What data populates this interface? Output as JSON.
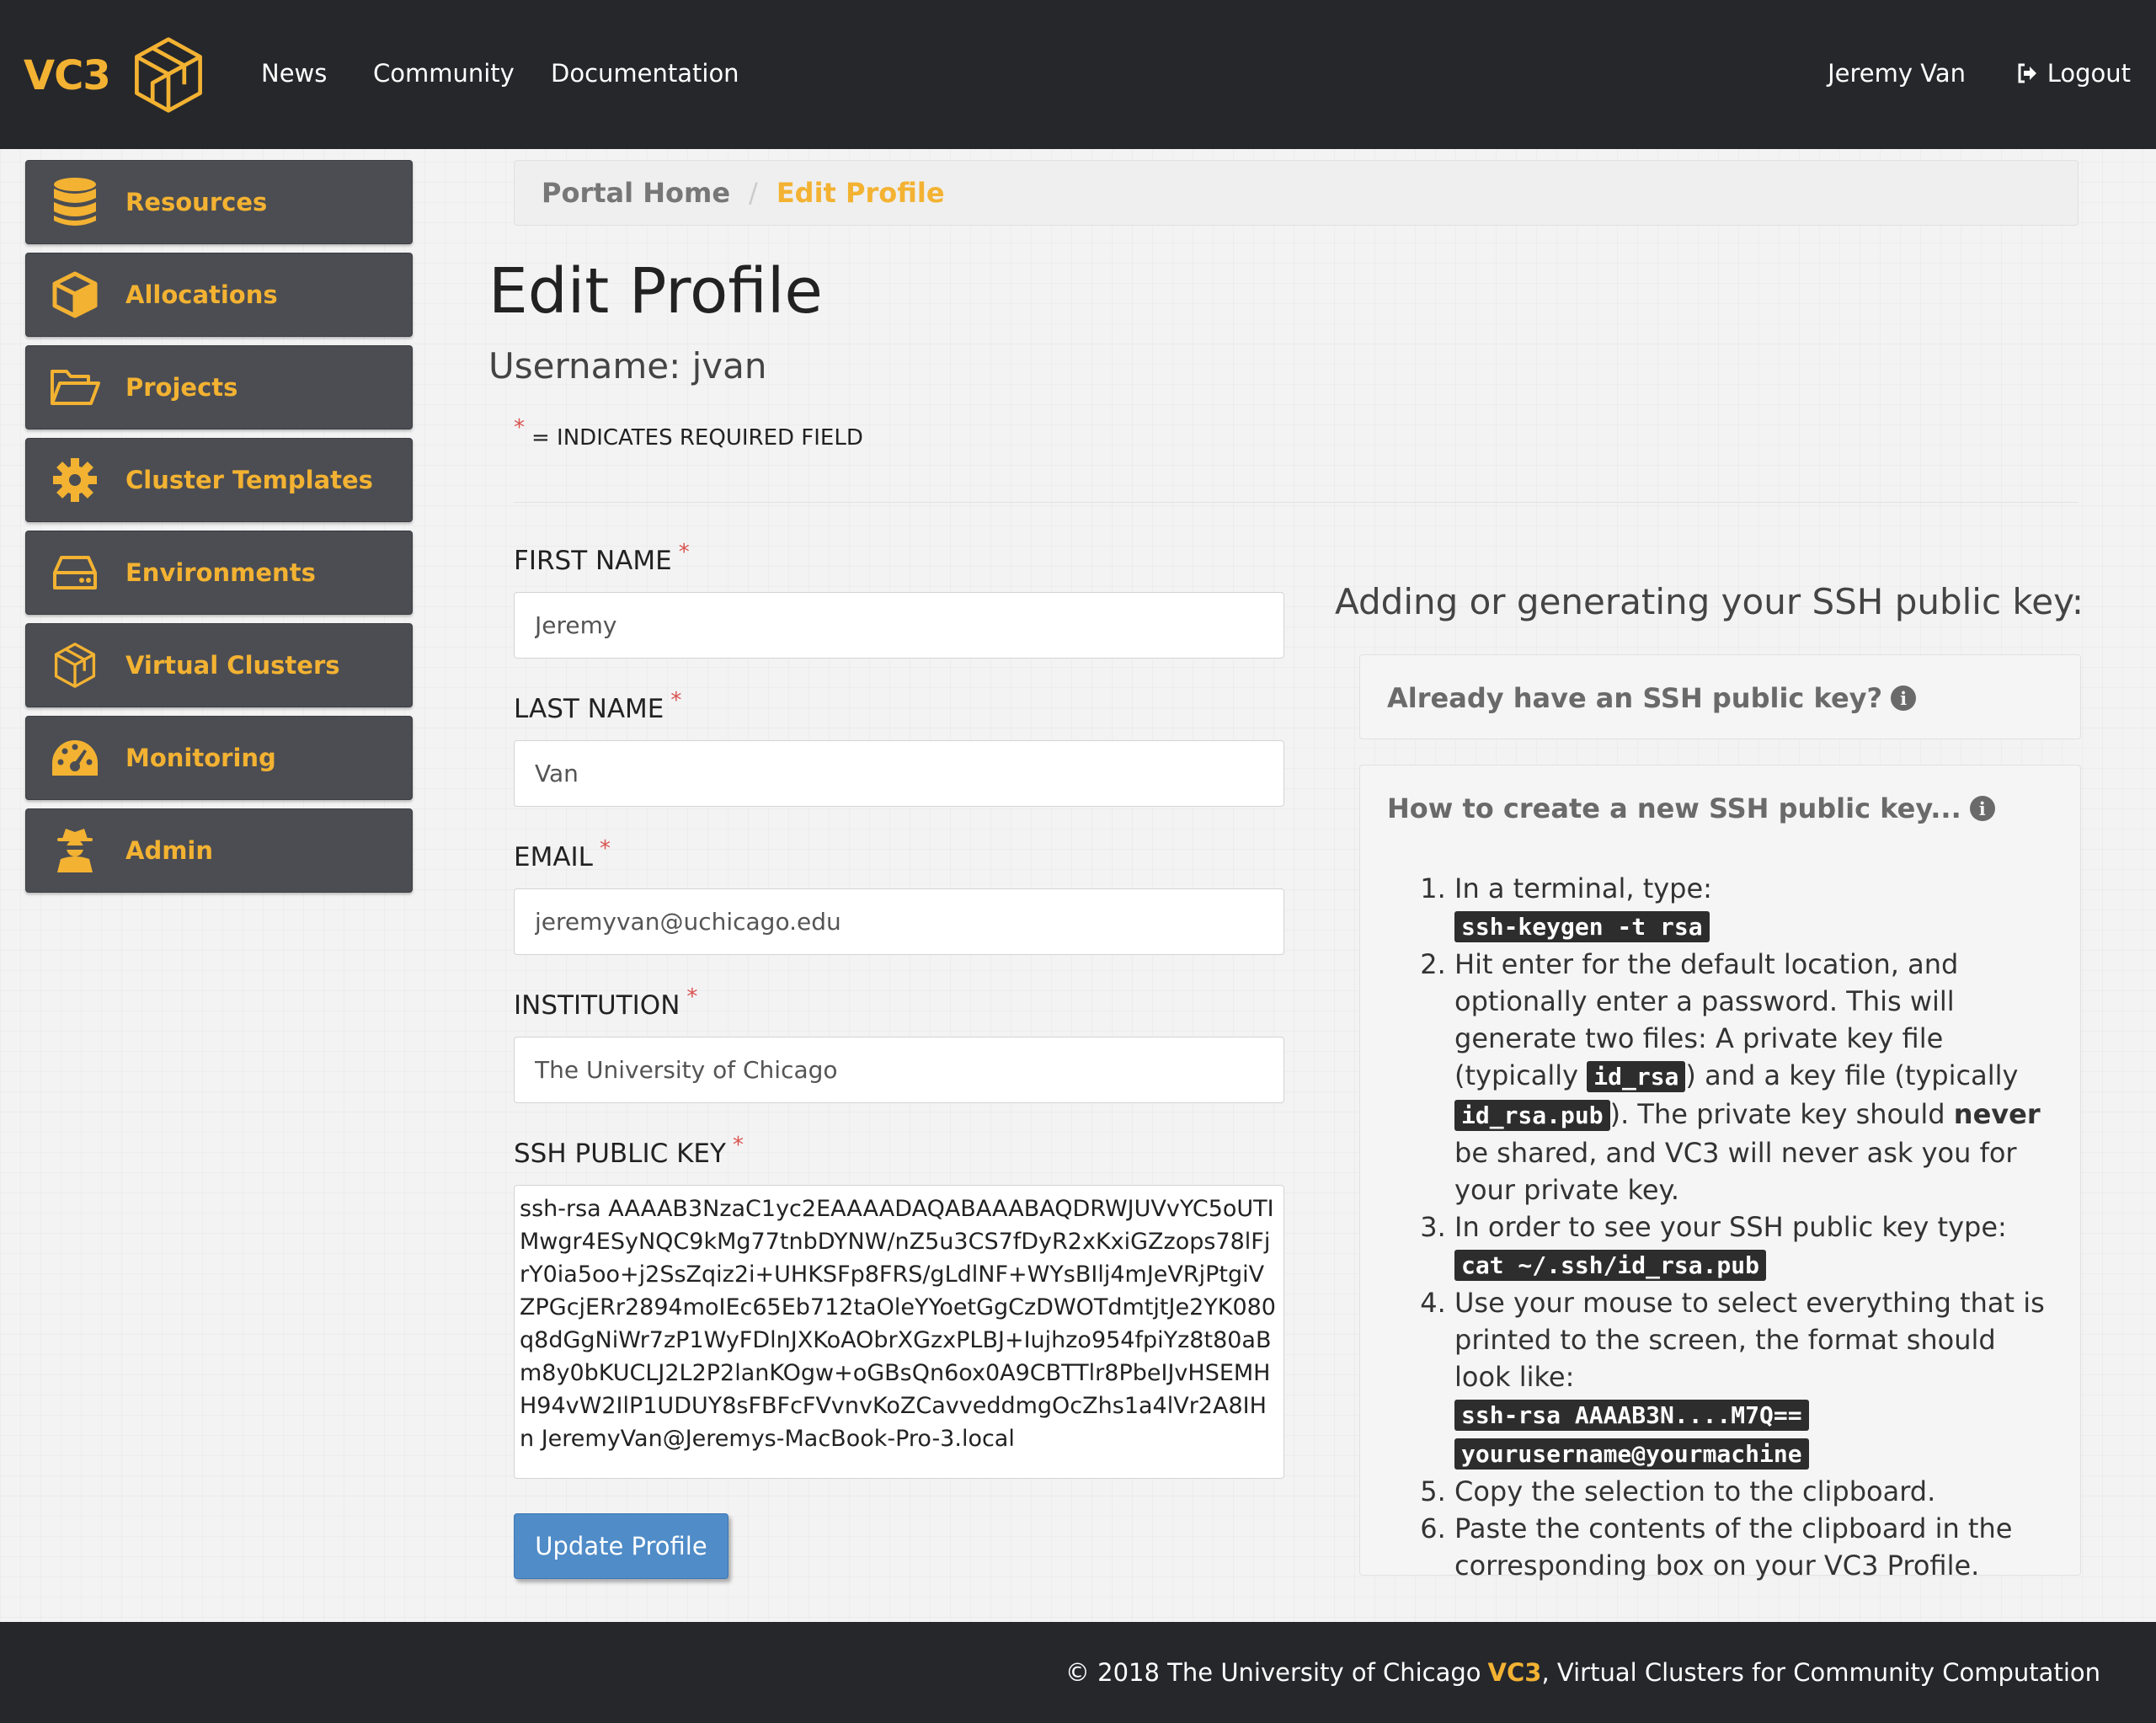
{
  "navbar": {
    "brand": "VC3",
    "links": [
      "News",
      "Community",
      "Documentation"
    ],
    "user": "Jeremy Van",
    "logout": "Logout"
  },
  "sidebar": {
    "items": [
      {
        "label": "Resources",
        "icon": "database-icon"
      },
      {
        "label": "Allocations",
        "icon": "cube-icon"
      },
      {
        "label": "Projects",
        "icon": "folder-open-icon"
      },
      {
        "label": "Cluster Templates",
        "icon": "gear-icon"
      },
      {
        "label": "Environments",
        "icon": "hard-drive-icon"
      },
      {
        "label": "Virtual Clusters",
        "icon": "vc3-cube-icon"
      },
      {
        "label": "Monitoring",
        "icon": "dashboard-icon"
      },
      {
        "label": "Admin",
        "icon": "user-secret-icon"
      }
    ]
  },
  "breadcrumb": {
    "home": "Portal Home",
    "separator": "/",
    "current": "Edit Profile"
  },
  "page": {
    "title": "Edit Profile",
    "username": "Username: jvan",
    "required_note": "= INDICATES REQUIRED FIELD",
    "required_star": "*"
  },
  "form": {
    "first_name_label": "FIRST NAME",
    "first_name_value": "Jeremy",
    "last_name_label": "LAST NAME",
    "last_name_value": "Van",
    "email_label": "EMAIL",
    "email_value": "jeremyvan@uchicago.edu",
    "institution_label": "INSTITUTION",
    "institution_value": "The University of Chicago",
    "ssh_label": "SSH PUBLIC KEY",
    "ssh_value": "ssh-rsa AAAAB3NzaC1yc2EAAAADAQABAAABAQDRWJUVvYC5oUTIMwgr4ESyNQC9kMg77tnbDYNW/nZ5u3CS7fDyR2xKxiGZzops78lFjrY0ia5oo+j2SsZqiz2i+UHKSFp8FRS/gLdlNF+WYsBIlj4mJeVRjPtgiVZPGcjERr2894moIEc65Eb712taOleYYoetGgCzDWOTdmtjtJe2YK080q8dGgNiWr7zP1WyFDlnJXKoAObrXGzxPLBJ+Iujhzo954fpiYz8t80aBm8y0bKUCLJ2L2P2lanKOgw+oGBsQn6ox0A9CBTTlr8PbeIJvHSEMHH94vW2IlP1UDUY8sFBFcFVvnvKoZCavveddmgOcZhs1a4lVr2A8IHn JeremyVan@Jeremys-MacBook-Pro-3.local",
    "submit": "Update Profile"
  },
  "help": {
    "title": "Adding or generating your SSH public key:",
    "panel1_title": "Already have an SSH public key?",
    "panel2_title": "How to create a new SSH public key...",
    "info_glyph": "i",
    "steps": {
      "s1_text": "In a terminal, type:",
      "s1_code": "ssh-keygen -t rsa",
      "s2_a": "Hit enter for the default location, and optionally enter a password. This will generate two files: A private key file (typically ",
      "s2_code1": "id_rsa",
      "s2_b": ") and a key file (typically ",
      "s2_code2": "id_rsa.pub",
      "s2_c": "). The private key should ",
      "s2_strong": "never",
      "s2_d": " be shared, and VC3 will never ask you for your private key.",
      "s3_text": "In order to see your SSH public key type:",
      "s3_code": "cat ~/.ssh/id_rsa.pub",
      "s4_text": "Use your mouse to select everything that is printed to the screen, the format should look like:",
      "s4_code1": "ssh-rsa AAAAB3N....M7Q==",
      "s4_code2": "yourusername@yourmachine",
      "s5_text": "Copy the selection to the clipboard.",
      "s6_text": "Paste the contents of the clipboard in the corresponding box on your VC3 Profile."
    }
  },
  "footer": {
    "text": "© 2018 The University of Chicago",
    "brand": "VC3",
    "tagline": ", Virtual Clusters for Community Computation"
  },
  "colors": {
    "accent": "#f3b232",
    "navbar": "#25272b",
    "sidebar_item": "#4b4d52",
    "button": "#4f8cc8",
    "required": "#d9534f"
  }
}
